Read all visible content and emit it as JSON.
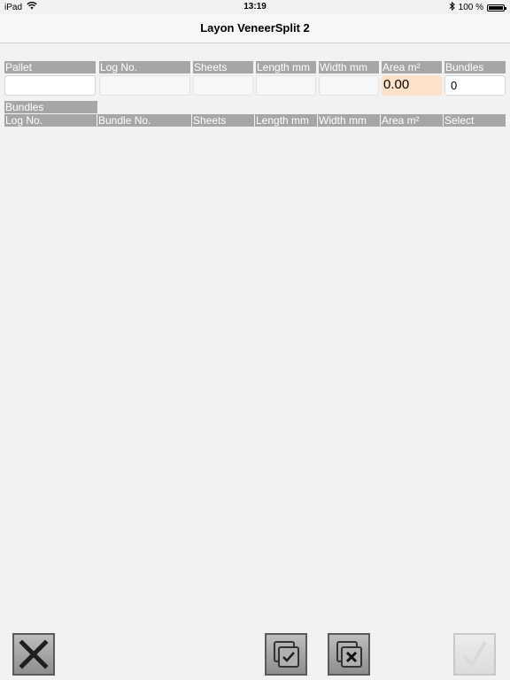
{
  "status_bar": {
    "device": "iPad",
    "time": "13:19",
    "battery": "100 %"
  },
  "nav": {
    "title": "Layon VeneerSplit 2"
  },
  "pallet_table": {
    "headers": [
      "Pallet",
      "Log No.",
      "Sheets",
      "Length mm",
      "Width mm",
      "Area m²",
      "Bundles"
    ],
    "values": {
      "area": "0.00",
      "bundles": "0"
    }
  },
  "bundles_section": {
    "title": "Bundles",
    "headers": [
      "Log No.",
      "Bundle No.",
      "Sheets",
      "Length mm",
      "Width mm",
      "Area m²",
      "Select"
    ]
  },
  "toolbar": {
    "icons": [
      "close-icon",
      "select-all-icon",
      "deselect-all-icon",
      "confirm-check-icon"
    ]
  }
}
